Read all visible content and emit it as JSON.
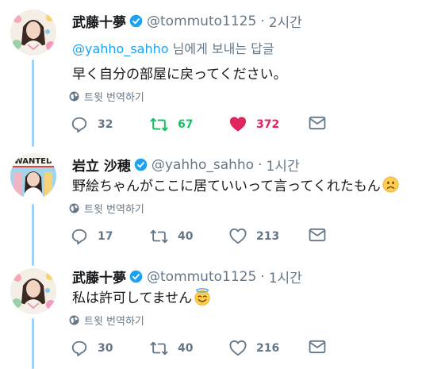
{
  "thread": {
    "translate_label": "트윗 번역하기",
    "tweets": [
      {
        "name": "武藤十夢",
        "handle": "@tommuto1125",
        "separator": "·",
        "time": "2시간",
        "reply_mention": "@yahho_sahho",
        "reply_suffix": " 님에게 보내는 답글",
        "text": "早く自分の部屋に戻ってください。",
        "reply_count": "32",
        "retweet_count": "67",
        "like_count": "372",
        "retweeted": true,
        "liked": true
      },
      {
        "name": "岩立 沙穂",
        "handle": "@yahho_sahho",
        "separator": "·",
        "time": "1시간",
        "avatar_banner": "WANTED",
        "text": "野絵ちゃんがここに居ていいって言ってくれたもん",
        "emoji": "frowning-face-emoji",
        "reply_count": "17",
        "retweet_count": "40",
        "like_count": "213",
        "retweeted": false,
        "liked": false
      },
      {
        "name": "武藤十夢",
        "handle": "@tommuto1125",
        "separator": "·",
        "time": "1시간",
        "text": "私は許可してません",
        "emoji": "smiling-face-with-halo-emoji",
        "reply_count": "30",
        "retweet_count": "40",
        "like_count": "216",
        "retweeted": false,
        "liked": false
      }
    ]
  },
  "colors": {
    "link": "#1da1f2",
    "muted": "#657786",
    "retweet_active": "#17bf63",
    "like_active": "#e0245e",
    "thread_line": "#9fd2f2"
  }
}
